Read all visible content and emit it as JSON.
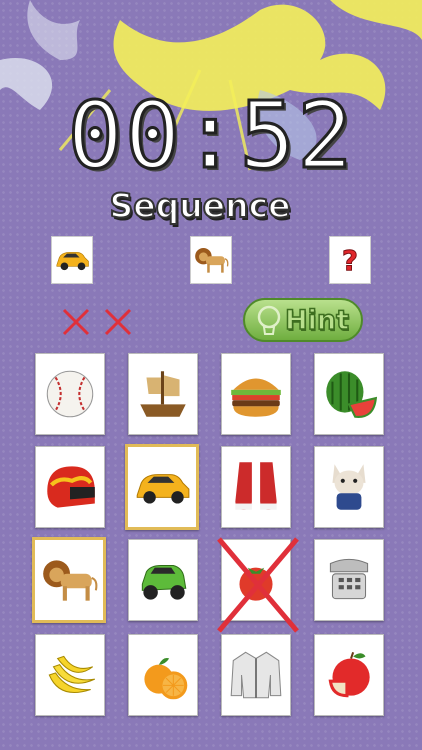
{
  "game": {
    "timer": "00:52",
    "mode_title": "Sequence",
    "hint_label": "Hint",
    "misses": 2
  },
  "sequence": [
    {
      "icon": "car-icon",
      "state": "shown"
    },
    {
      "icon": "lion-icon",
      "state": "shown"
    },
    {
      "icon": "question-mark-icon",
      "state": "hidden"
    }
  ],
  "grid": [
    {
      "icon": "baseball-icon",
      "selected": false
    },
    {
      "icon": "ship-icon",
      "selected": false
    },
    {
      "icon": "burger-icon",
      "selected": false
    },
    {
      "icon": "watermelon-icon",
      "selected": false
    },
    {
      "icon": "helmet-icon",
      "selected": false
    },
    {
      "icon": "car-icon",
      "selected": true
    },
    {
      "icon": "sneakers-icon",
      "selected": false
    },
    {
      "icon": "bulldog-icon",
      "selected": false
    },
    {
      "icon": "lion-icon",
      "selected": true
    },
    {
      "icon": "toy-car-icon",
      "selected": false
    },
    {
      "icon": "tomato-icon",
      "selected": false,
      "wrong": true
    },
    {
      "icon": "telephone-icon",
      "selected": false
    },
    {
      "icon": "banana-icon",
      "selected": false
    },
    {
      "icon": "orange-icon",
      "selected": false
    },
    {
      "icon": "jacket-icon",
      "selected": false
    },
    {
      "icon": "apple-icon",
      "selected": false
    }
  ],
  "colors": {
    "background": "#8a79b8",
    "splash_yellow": "#f4f05a",
    "select_border": "#e1bb57",
    "wrong_cross": "#e0303a",
    "hint_green": "#8cc65a"
  }
}
